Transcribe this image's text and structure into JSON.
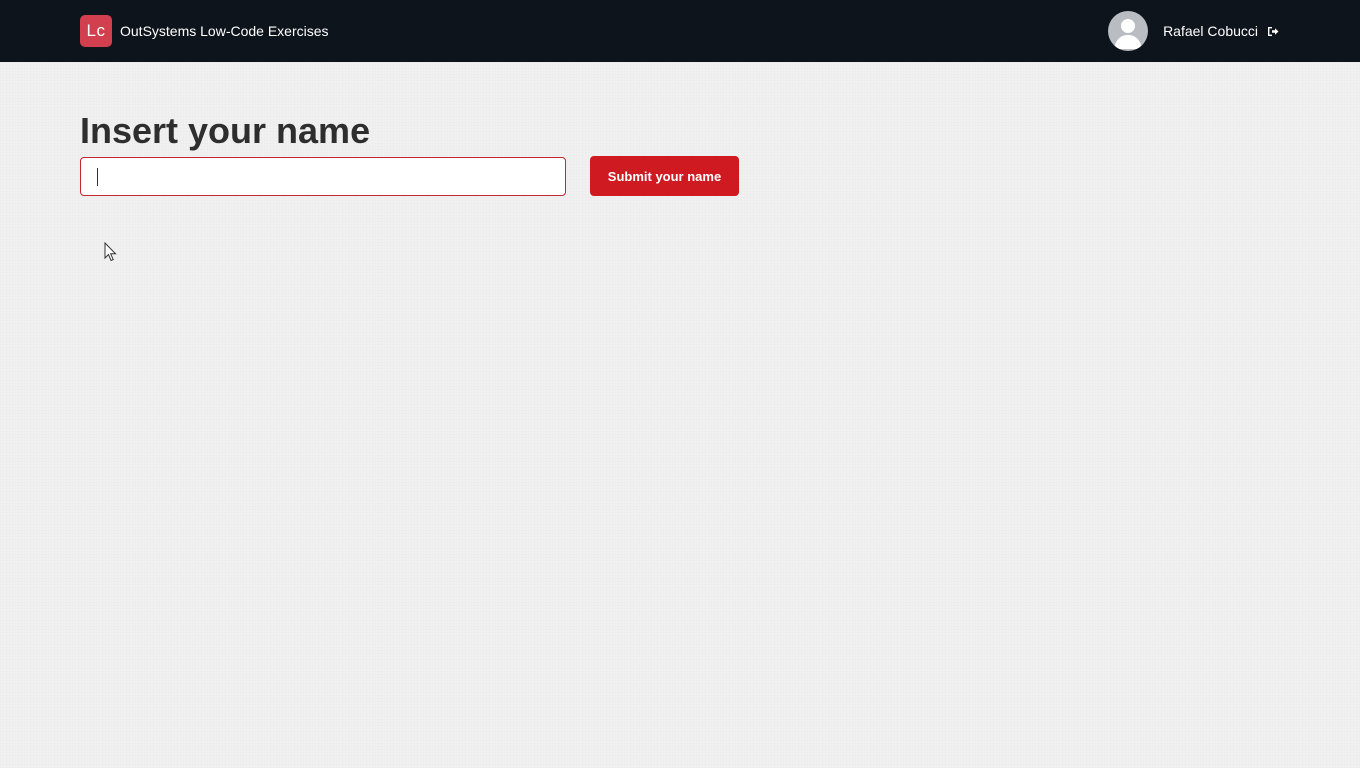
{
  "header": {
    "logo_text": "Lc",
    "app_title": "OutSystems Low-Code Exercises",
    "user_name": "Rafael Cobucci",
    "logout_icon": "sign-out-icon"
  },
  "main": {
    "title": "Insert your name",
    "name_input": {
      "value": "",
      "placeholder": ""
    },
    "submit_label": "Submit your name"
  },
  "colors": {
    "header_bg": "#0d141b",
    "logo_bg": "#d2404f",
    "accent": "#cf1a22",
    "page_bg": "#f1f1f1"
  }
}
